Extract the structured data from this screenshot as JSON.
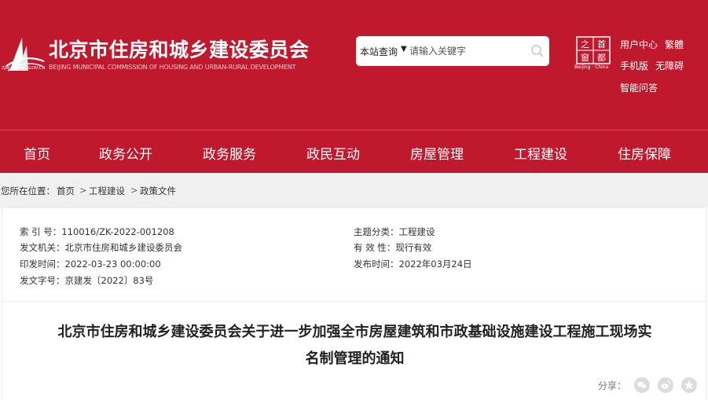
{
  "header": {
    "site_title": "北京市住房和城乡建设委员会",
    "site_title_en": "BEIJING MUNICIPAL COMMISSION OF HOUSING AND URBAN-RURAL DEVELOPMENT",
    "logo_domain": "ZJW.BEIJING.GOV.CN",
    "brand_color": "#c0192e",
    "search": {
      "scope_label": "本站查询",
      "placeholder": "请输入关键字"
    },
    "seal_chars": [
      "首",
      "之",
      "都",
      "窗"
    ],
    "seal_caption": "Beijing · China",
    "utility_links": [
      "用户中心",
      "繁體",
      "手机版",
      "无障碍",
      "智能问答"
    ]
  },
  "nav": {
    "items": [
      "首页",
      "政务公开",
      "政务服务",
      "政民互动",
      "房屋管理",
      "工程建设",
      "住房保障"
    ]
  },
  "breadcrumb": {
    "prefix": "您所在位置：",
    "items": [
      "首页",
      "工程建设",
      "政策文件"
    ],
    "separator": ">"
  },
  "meta": {
    "index_no_label": "索 引 号：",
    "index_no": "110016/ZK-2022-001208",
    "issuer_label": "发文机关：",
    "issuer": "北京市住房和城乡建设委员会",
    "print_date_label": "印发时间：",
    "print_date": "2022-03-23 00:00:00",
    "doc_no_label": "发文字号：",
    "doc_no": "京建发〔2022〕83号",
    "subject_label": "主题分类：",
    "subject": "工程建设",
    "validity_label": "有 效 性：",
    "validity": "现行有效",
    "publish_date_label": "发布时间：",
    "publish_date": "2022年03月24日"
  },
  "document": {
    "title_line1": "北京市住房和城乡建设委员会关于进一步加强全市房屋建筑和市政基础设施建设工程施工现场实",
    "title_line2": "名制管理的通知",
    "share_label": "分享："
  }
}
